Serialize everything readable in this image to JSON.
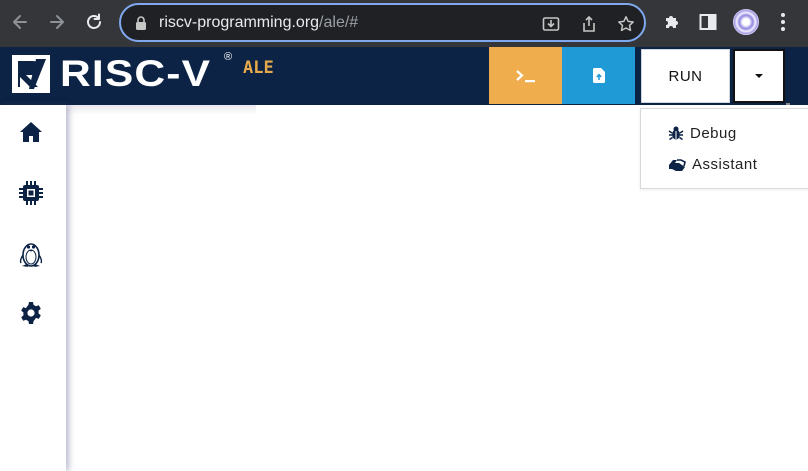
{
  "browser": {
    "url_host": "riscv-programming.org",
    "url_path": "/ale/#",
    "icons": [
      "back-icon",
      "forward-icon",
      "reload-icon",
      "lock-icon",
      "install-icon",
      "share-icon",
      "bookmark-star-icon",
      "extensions-icon",
      "side-panel-icon",
      "profile-avatar",
      "more-menu-icon"
    ]
  },
  "header": {
    "logo_text": "RISC-V",
    "logo_reg": "®",
    "logo_suffix": "ALE",
    "console_icon": "terminal-icon",
    "upload_icon": "file-upload-icon",
    "run_label": "RUN",
    "caret_icon": "caret-down-icon",
    "colors": {
      "header_bg": "#0c2345",
      "console_bg": "#f0ad4e",
      "upload_bg": "#1f9ad6",
      "ale_text": "#e8a94a"
    }
  },
  "sidebar": {
    "items": [
      {
        "name": "home",
        "icon": "home-icon"
      },
      {
        "name": "cpu",
        "icon": "cpu-chip-icon"
      },
      {
        "name": "linux",
        "icon": "linux-tux-icon"
      },
      {
        "name": "settings",
        "icon": "gear-icon"
      }
    ]
  },
  "dropdown": {
    "items": [
      {
        "label": "Debug",
        "icon": "bug-icon"
      },
      {
        "label": "Assistant",
        "icon": "handshake-icon"
      }
    ]
  }
}
